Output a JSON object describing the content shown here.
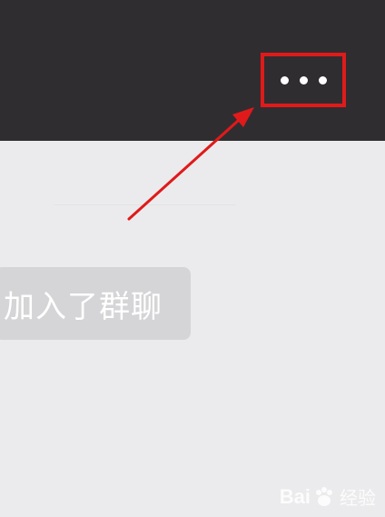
{
  "header": {
    "more_button": {
      "icon": "more-dots-icon",
      "highlight_color": "#e01a1a"
    }
  },
  "chat": {
    "system_message": "加入了群聊"
  },
  "annotation": {
    "arrow_color": "#e01a1a"
  },
  "watermark": {
    "brand": "Bai",
    "paw_icon": "paw-icon",
    "brand_suffix": "经验"
  },
  "colors": {
    "header_bg": "#302d31",
    "chat_bg": "#ebebed"
  }
}
